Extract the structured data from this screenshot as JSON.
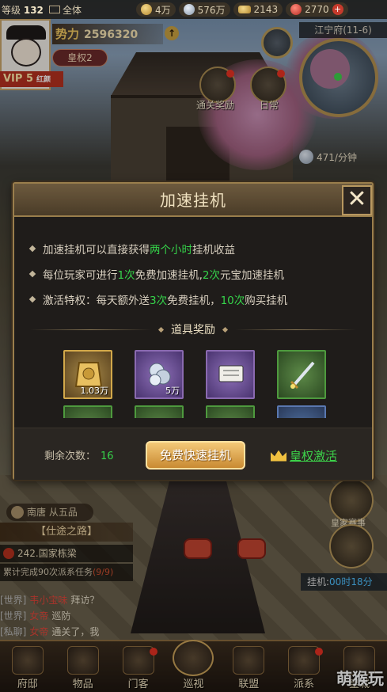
{
  "topbar": {
    "level_label": "等级",
    "level_value": "132",
    "channel": "全体",
    "currencies": [
      {
        "icon": "food-bag-icon",
        "value": "4万"
      },
      {
        "icon": "silver-icon",
        "value": "576万"
      },
      {
        "icon": "ingot-icon",
        "value": "2143"
      },
      {
        "icon": "red-gem-icon",
        "value": "2770"
      }
    ]
  },
  "player": {
    "power_label": "势力",
    "power_value": "2596320",
    "rank": "皇权2",
    "vip": "VIP 5",
    "vip_sub": "红颜"
  },
  "map": {
    "city": "江宁府(11-6)",
    "income": "471/分钟"
  },
  "quests": [
    {
      "label": "通关奖励"
    },
    {
      "label": "日常"
    }
  ],
  "modal": {
    "title": "加速挂机",
    "close": "✕",
    "rules": [
      {
        "pre": "加速挂机可以直接获得",
        "hl": "两个小时",
        "post": "挂机收益"
      },
      {
        "pre": "每位玩家可进行",
        "hl": "1次",
        "mid": "免费加速挂机,",
        "hl2": "2次",
        "post": "元宝加速挂机"
      },
      {
        "pre": "激活特权：每天额外送",
        "hl": "3次",
        "mid": "免费挂机，",
        "hl2": "10次",
        "post": "购买挂机"
      }
    ],
    "rewards_title": "道具奖励",
    "items": [
      {
        "name": "food-token-icon",
        "qty": "1.03万",
        "rarity": "gold"
      },
      {
        "name": "silver-coins-icon",
        "qty": "5万",
        "rarity": "purple"
      },
      {
        "name": "scroll-book-icon",
        "qty": "",
        "rarity": "purple"
      },
      {
        "name": "sword-icon",
        "qty": "",
        "rarity": "green"
      }
    ],
    "remain_label": "剩余次数：",
    "remain_value": "16",
    "free_button": "免费快速挂机",
    "crown_link": "皇权激活"
  },
  "officer": "南唐 从五品",
  "banner": "【仕途之路】",
  "task": {
    "title": "242.国家栋梁",
    "desc": "累计完成90次派系任务",
    "progress": "(9/9)"
  },
  "chat": [
    {
      "channel": "[世界]",
      "name": "韦小宝味",
      "msg": "拜访？"
    },
    {
      "channel": "[世界]",
      "name": "女帝",
      "msg": "巡防"
    },
    {
      "channel": "[私聊]",
      "name": "女帝",
      "msg": "通关了，我"
    }
  ],
  "hangup": {
    "label": "挂机:",
    "time": "00时18分"
  },
  "side_label": "皇家赛事",
  "nav": [
    {
      "label": "府邸",
      "icon": "mansion-icon"
    },
    {
      "label": "物品",
      "icon": "bag-icon"
    },
    {
      "label": "门客",
      "icon": "retainer-icon"
    },
    {
      "label": "巡视",
      "icon": "patrol-icon"
    },
    {
      "label": "联盟",
      "icon": "alliance-icon"
    },
    {
      "label": "派系",
      "icon": "faction-icon"
    },
    {
      "label": "皇城",
      "icon": "palace-icon"
    }
  ],
  "watermark": "萌猴玩"
}
